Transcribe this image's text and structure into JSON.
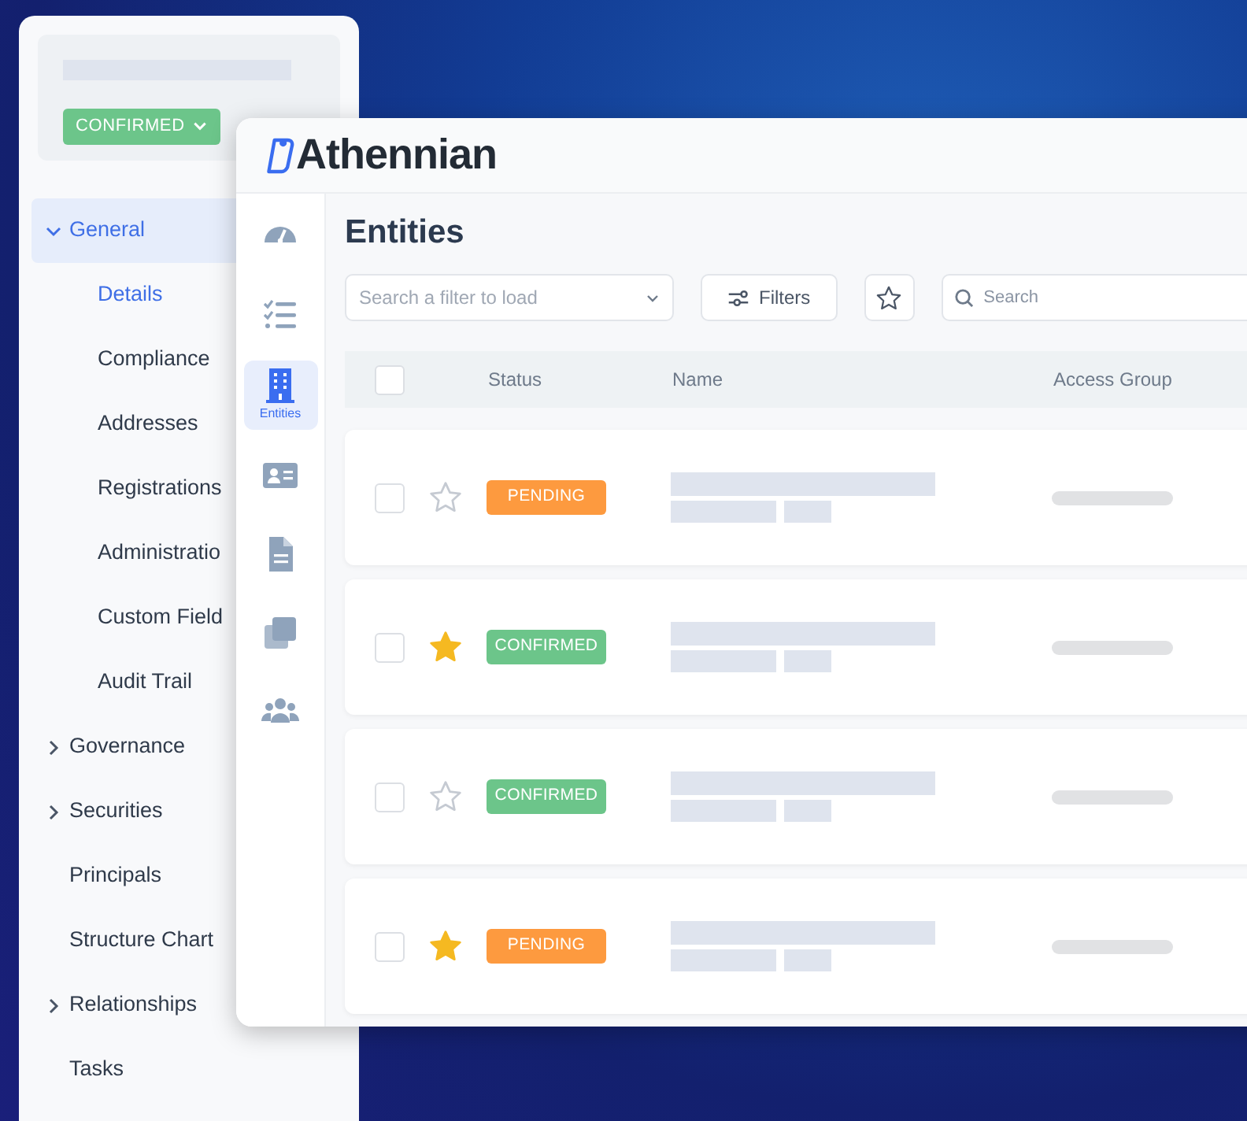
{
  "side_panel": {
    "status": {
      "label": "CONFIRMED",
      "kind": "confirmed"
    },
    "nav": [
      {
        "kind": "group",
        "label": "General",
        "expanded": true,
        "selected": true,
        "children": [
          {
            "label": "Details",
            "selected": true
          },
          {
            "label": "Compliance",
            "selected": false
          },
          {
            "label": "Addresses",
            "selected": false
          },
          {
            "label": "Registrations",
            "selected": false
          },
          {
            "label": "Administratio",
            "selected": false
          },
          {
            "label": "Custom Field",
            "selected": false
          },
          {
            "label": "Audit Trail",
            "selected": false
          }
        ]
      },
      {
        "kind": "group",
        "label": "Governance",
        "expanded": false,
        "selected": false
      },
      {
        "kind": "group",
        "label": "Securities",
        "expanded": false,
        "selected": false
      },
      {
        "kind": "link",
        "label": "Principals",
        "selected": false
      },
      {
        "kind": "link",
        "label": "Structure Chart",
        "selected": false
      },
      {
        "kind": "group",
        "label": "Relationships",
        "expanded": false,
        "selected": false
      },
      {
        "kind": "link",
        "label": "Tasks",
        "selected": false
      }
    ]
  },
  "app": {
    "logo": "Athennian",
    "rail": [
      {
        "selected": false
      },
      {
        "selected": false
      },
      {
        "label": "Entities",
        "selected": true
      },
      {
        "selected": false
      },
      {
        "selected": false
      },
      {
        "selected": false
      },
      {
        "selected": false
      }
    ],
    "title": "Entities",
    "filter_select": {
      "placeholder": "Search a filter to load"
    },
    "filters_button": "Filters",
    "search": {
      "placeholder": "Search"
    },
    "table": {
      "header_checked": false,
      "columns": [
        "Status",
        "Name",
        "Access Group"
      ],
      "rows": [
        {
          "checked": false,
          "starred": false,
          "status": "PENDING",
          "color": "#fd9a3f"
        },
        {
          "checked": false,
          "starred": true,
          "status": "CONFIRMED",
          "color": "#6cc58a"
        },
        {
          "checked": false,
          "starred": false,
          "status": "CONFIRMED",
          "color": "#6cc58a"
        },
        {
          "checked": false,
          "starred": true,
          "status": "PENDING",
          "color": "#fd9a3f"
        }
      ]
    }
  }
}
